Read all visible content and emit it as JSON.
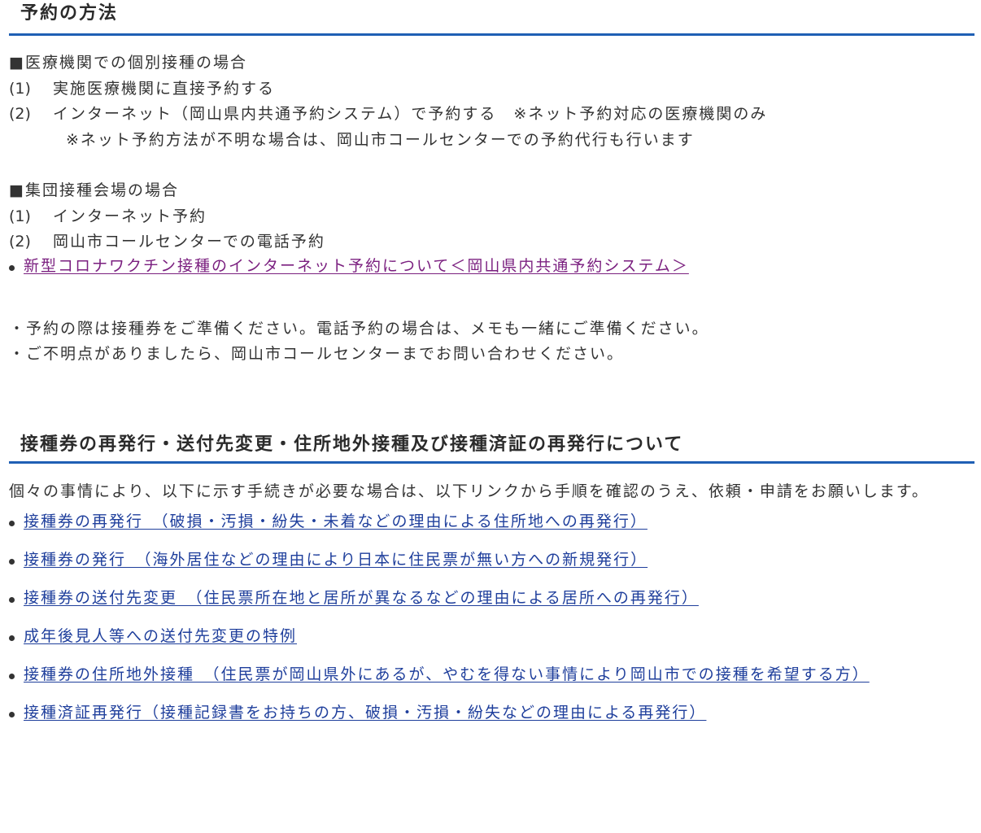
{
  "section_reservation": {
    "title": "予約の方法",
    "individual": {
      "header": "■医療機関での個別接種の場合",
      "items": [
        {
          "num": "(1)",
          "text": "実施医療機関に直接予約する"
        },
        {
          "num": "(2)",
          "text": "インターネット（岡山県内共通予約システム）で予約する　※ネット予約対応の医療機関のみ"
        }
      ],
      "note": "※ネット予約方法が不明な場合は、岡山市コールセンターでの予約代行も行います"
    },
    "group": {
      "header": "■集団接種会場の場合",
      "items": [
        {
          "num": "(1)",
          "text": "インターネット予約"
        },
        {
          "num": "(2)",
          "text": "岡山市コールセンターでの電話予約"
        }
      ]
    },
    "link": "新型コロナワクチン接種のインターネット予約について＜岡山県内共通予約システム＞",
    "notes": [
      "・予約の際は接種券をご準備ください。電話予約の場合は、メモも一緒にご準備ください。",
      "・ご不明点がありましたら、岡山市コールセンターまでお問い合わせください。"
    ]
  },
  "section_reissue": {
    "title": "接種券の再発行・送付先変更・住所地外接種及び接種済証の再発行について",
    "intro": "個々の事情により、以下に示す手続きが必要な場合は、以下リンクから手順を確認のうえ、依頼・申請をお願いします。",
    "links": [
      "接種券の再発行　（破損・汚損・紛失・未着などの理由による住所地への再発行）",
      "接種券の発行　（海外居住などの理由により日本に住民票が無い方への新規発行）",
      "接種券の送付先変更　（住民票所在地と居所が異なるなどの理由による居所への再発行）",
      "成年後見人等への送付先変更の特例",
      "接種券の住所地外接種　（住民票が岡山県外にあるが、やむを得ない事情により岡山市での接種を希望する方）",
      "接種済証再発行（接種記録書をお持ちの方、破損・汚損・紛失などの理由による再発行）"
    ]
  },
  "colors": {
    "accent_rule": "#1f5fb4",
    "link": "#1f3f9c",
    "visited_link": "#7a1f7f",
    "text": "#333333"
  }
}
